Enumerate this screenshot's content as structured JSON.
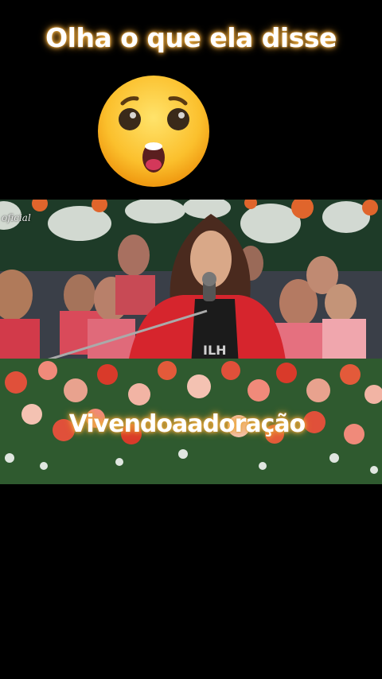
{
  "header": {
    "caption": "Olha o que ela disse",
    "emoji_icon": "astonished-face-icon"
  },
  "video": {
    "watermark": "oficial",
    "overlay_caption": "Vivendoaadoração"
  },
  "colors": {
    "background": "#000000",
    "caption_glow": "#f3b54a",
    "emoji_face": "#fbc02d"
  }
}
